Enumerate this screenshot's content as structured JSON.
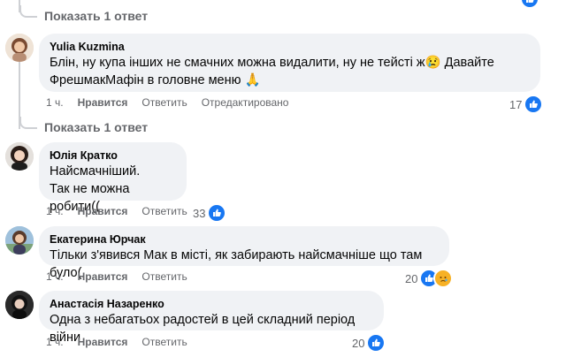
{
  "top_reply": {
    "label": "Показать 1 ответ"
  },
  "comments": [
    {
      "author": "Yulia Kuzmina",
      "text": "Блін, ну купа інших не смачних можна видалити, ну не тейсті ж😢 Давайте\nФрешмакМафін в головне меню 🙏",
      "time": "1 ч.",
      "like_label": "Нравится",
      "reply_label": "Ответить",
      "edited_label": "Отредактировано",
      "reactions": "17",
      "reply_toggle": "Показать 1 ответ"
    },
    {
      "author": "Юлія Кратко",
      "text": "Найсмачніший.\nТак не можна робити((",
      "time": "1 ч.",
      "like_label": "Нравится",
      "reply_label": "Ответить",
      "reactions": "33"
    },
    {
      "author": "Екатерина Юрчак",
      "text": "Тільки з'явився Мак в місті, як забирають найсмачніше що там було(",
      "time": "1 ч.",
      "like_label": "Нравится",
      "reply_label": "Ответить",
      "reactions": "20"
    },
    {
      "author": "Анастасія Назаренко",
      "text": "Одна з небагатьох радостей в цей складний період війни",
      "time": "1 ч.",
      "like_label": "Нравится",
      "reply_label": "Ответить",
      "reactions": "20"
    }
  ],
  "colors": {
    "like": "#1877f2",
    "bubble": "#f0f2f5",
    "meta": "#65676b"
  }
}
